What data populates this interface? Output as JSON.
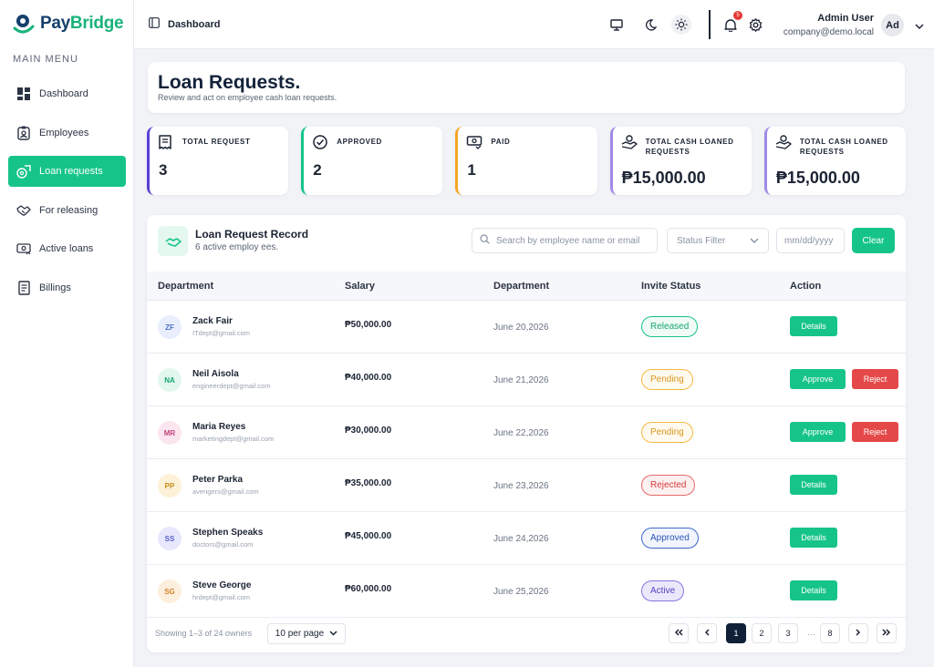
{
  "brand": {
    "part1": "Pay",
    "part2": "Bridge",
    "accent": "#19b37a",
    "primary": "#16406b"
  },
  "sidebar": {
    "menu_title": "MAIN MENU",
    "items": [
      {
        "label": "Dashboard",
        "icon": "dashboard-icon"
      },
      {
        "label": "Employees",
        "icon": "id-badge-icon"
      },
      {
        "label": "Loan requests",
        "icon": "money-icon",
        "active": true
      },
      {
        "label": "For releasing",
        "icon": "handshake-icon"
      },
      {
        "label": "Active loans",
        "icon": "cash-icon"
      },
      {
        "label": "Billings",
        "icon": "document-icon"
      }
    ]
  },
  "topbar": {
    "breadcrumb": "Dashboard",
    "notification_count": "5",
    "user_name": "Admin User",
    "user_email": "company@demo.local",
    "avatar_initials": "Ad"
  },
  "page": {
    "title": "Loan Requests.",
    "subtitle": "Review and act on employee cash loan requests."
  },
  "stats": [
    {
      "label": "TOTAL REQUEST",
      "value": "3",
      "color": "#5b3fd6",
      "icon": "receipt-icon"
    },
    {
      "label": "APPROVED",
      "value": "2",
      "color": "#16c48a",
      "icon": "check-circle-icon"
    },
    {
      "label": "PAID",
      "value": "1",
      "color": "#f5a623",
      "icon": "paid-icon"
    },
    {
      "label": "TOTAL CASH LOANED REQUESTS",
      "value": "₱15,000.00",
      "color": "#a08ae6",
      "icon": "hand-money-icon"
    },
    {
      "label": "TOTAL CASH LOANED REQUESTS",
      "value": "₱15,000.00",
      "color": "#a08ae6",
      "icon": "hand-money-icon"
    }
  ],
  "record": {
    "title": "Loan Request Record",
    "subtitle": "6 active employ ees.",
    "search_placeholder": "Search by employee name or email",
    "status_filter": "Status Filter",
    "date_placeholder": "mm/dd/yyyy",
    "clear_label": "Clear"
  },
  "table": {
    "columns": [
      "Department",
      "Salary",
      "Department",
      "Invite Status",
      "Action"
    ],
    "rows": [
      {
        "initials": "ZF",
        "name": "Zack Fair",
        "email": "ITdept@gmail.com",
        "salary": "₱50,000.00",
        "date": "June 20,2026",
        "status": "Released",
        "actions": [
          "Details"
        ]
      },
      {
        "initials": "NA",
        "name": "Neil Aisola",
        "email": "engineerdept@gmail.com",
        "salary": "₱40,000.00",
        "date": "June 21,2026",
        "status": "Pending",
        "actions": [
          "Approve",
          "Reject"
        ]
      },
      {
        "initials": "MR",
        "name": "Maria Reyes",
        "email": "marketingdept@gmail.com",
        "salary": "₱30,000.00",
        "date": "June 22,2026",
        "status": "Pending",
        "actions": [
          "Approve",
          "Reject"
        ]
      },
      {
        "initials": "PP",
        "name": "Peter Parka",
        "email": "avengers@gmail.com",
        "salary": "₱35,000.00",
        "date": "June 23,2026",
        "status": "Rejected",
        "actions": [
          "Details"
        ]
      },
      {
        "initials": "SS",
        "name": "Stephen Speaks",
        "email": "doctors@gmail.com",
        "salary": "₱45,000.00",
        "date": "June 24,2026",
        "status": "Approved",
        "actions": [
          "Details"
        ]
      },
      {
        "initials": "SG",
        "name": "Steve George",
        "email": "hrdept@gmail.com",
        "salary": "₱60,000.00",
        "date": "June 25,2026",
        "status": "Active",
        "actions": [
          "Details"
        ]
      }
    ]
  },
  "pagination": {
    "showing": "Showing 1–3 of 24 owners",
    "per_page": "10 per page",
    "pages": [
      "1",
      "2",
      "3",
      "8"
    ],
    "current": "1",
    "ellipsis": "…"
  }
}
